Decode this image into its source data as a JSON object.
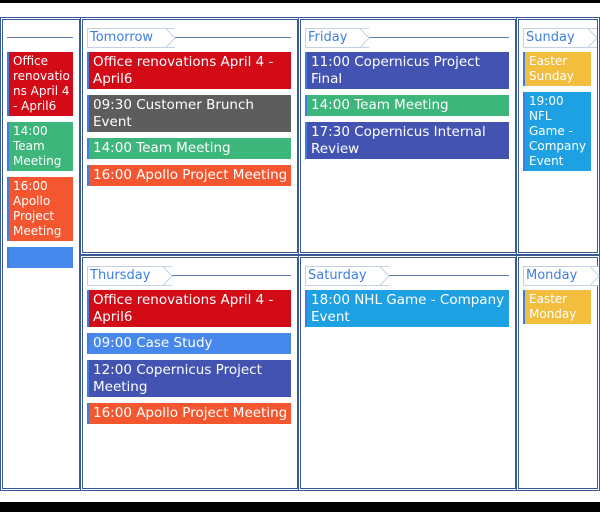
{
  "colors": {
    "red": "#d20b17",
    "green": "#3cb67a",
    "orange": "#f4572f",
    "blue": "#4688ec",
    "indigo": "#4353b2",
    "gray": "#5d5d5d",
    "sky": "#1ea1e2",
    "yellow": "#f3bd3e",
    "border": "#3a5a94",
    "header_text": "#3d7ee0"
  },
  "days": [
    {
      "label": "",
      "events": [
        {
          "text": "Office renovations April 4 - April6",
          "color": "red"
        },
        {
          "text": "14:00 Team Meeting",
          "color": "green"
        },
        {
          "text": "16:00 Apollo Project Meeting",
          "color": "orange"
        },
        {
          "text": "",
          "color": "blue"
        }
      ]
    },
    {
      "label": "Tomorrow",
      "events": [
        {
          "text": "Office renovations April 4 - April6",
          "color": "red"
        },
        {
          "text": "09:30 Customer Brunch Event",
          "color": "gray"
        },
        {
          "text": "14:00 Team Meeting",
          "color": "green"
        },
        {
          "text": "16:00 Apollo Project Meeting",
          "color": "orange"
        }
      ]
    },
    {
      "label": "Thursday",
      "events": [
        {
          "text": "Office renovations April 4 - April6",
          "color": "red"
        },
        {
          "text": "09:00 Case Study",
          "color": "blue"
        },
        {
          "text": "12:00 Copernicus Project Meeting",
          "color": "indigo"
        },
        {
          "text": "16:00 Apollo Project Meeting",
          "color": "orange"
        }
      ]
    },
    {
      "label": "Friday",
      "events": [
        {
          "text": "11:00 Copernicus Project Final",
          "color": "indigo"
        },
        {
          "text": "14:00 Team Meeting",
          "color": "green"
        },
        {
          "text": "17:30 Copernicus Internal Review",
          "color": "indigo"
        }
      ]
    },
    {
      "label": "Saturday",
      "events": [
        {
          "text": "18:00 NHL Game - Company Event",
          "color": "sky"
        }
      ]
    },
    {
      "label": "Sunday",
      "events": [
        {
          "text": "Easter Sunday",
          "color": "yellow"
        },
        {
          "text": "19:00 NFL Game - Company Event",
          "color": "sky"
        }
      ]
    },
    {
      "label": "Monday",
      "events": [
        {
          "text": "Easter Monday",
          "color": "yellow"
        }
      ]
    }
  ]
}
